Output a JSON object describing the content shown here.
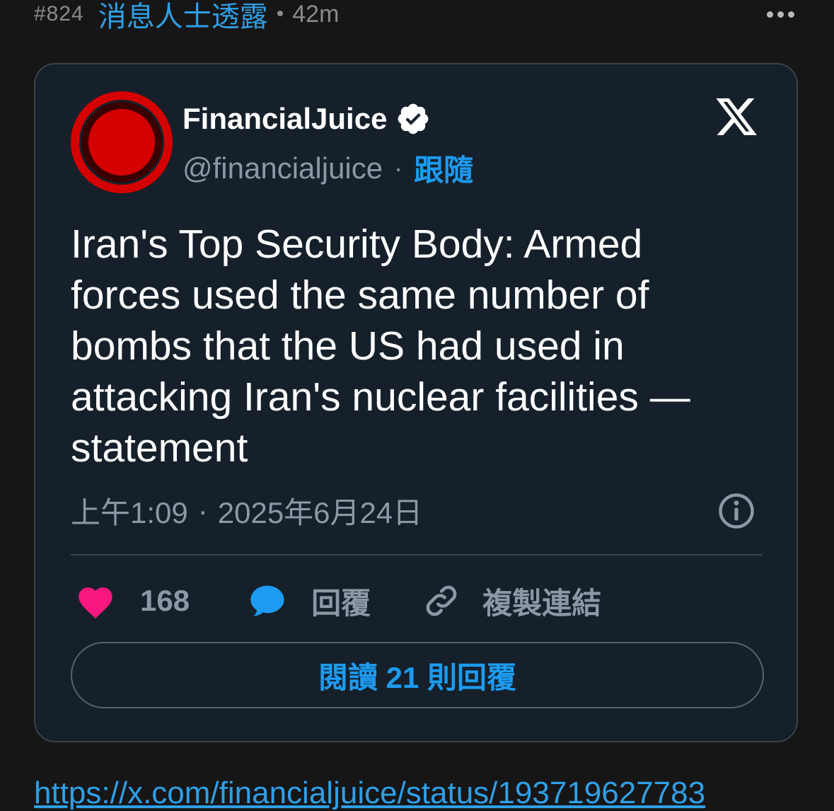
{
  "post": {
    "number": "#824",
    "author": "消息人士透露",
    "separator": "•",
    "time": "42m"
  },
  "tweet": {
    "display_name": "FinancialJuice",
    "handle": "@financialjuice",
    "dot": "·",
    "follow_label": "跟隨",
    "text": "Iran's Top Security Body: Armed forces used the same number of bombs that the US had used in attacking Iran's nuclear facilities — statement",
    "time": "上午1:09",
    "date_sep": "·",
    "date": "2025年6月24日",
    "likes": "168",
    "reply_label": "回覆",
    "copy_label": "複製連結",
    "read_replies_label": "閱讀 21 則回覆"
  },
  "link": "https://x.com/financialjuice/status/193719627783",
  "colors": {
    "background": "#161616",
    "card": "#15202b",
    "accent": "#1d9bf0",
    "heart": "#f91880",
    "avatar_red": "#d50000"
  },
  "icons": [
    "more-options-icon",
    "verified-badge-icon",
    "x-logo-icon",
    "info-icon",
    "heart-icon",
    "reply-icon",
    "link-icon"
  ]
}
